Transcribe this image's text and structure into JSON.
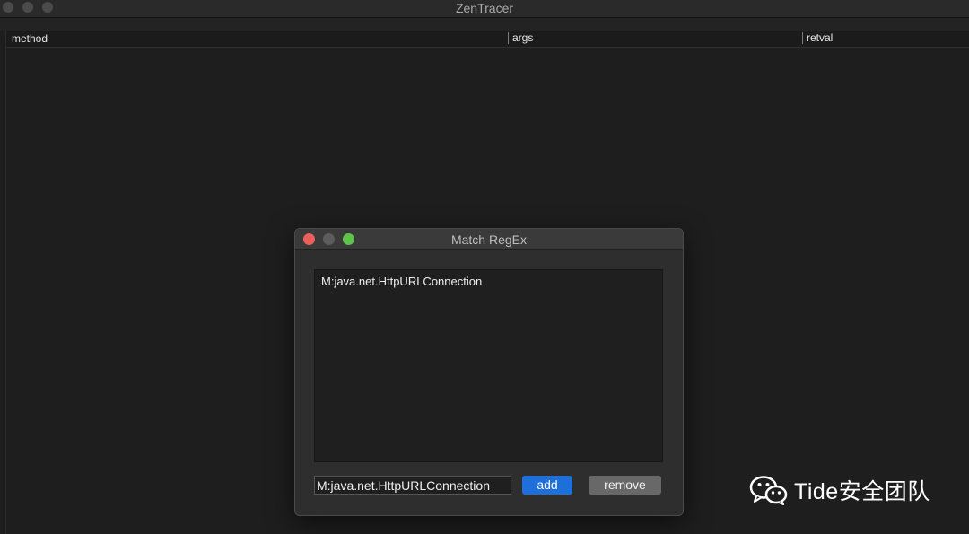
{
  "window": {
    "title": "ZenTracer"
  },
  "table": {
    "columns": [
      "method",
      "args",
      "retval"
    ]
  },
  "dialog": {
    "title": "Match RegEx",
    "list_items": [
      "M:java.net.HttpURLConnection"
    ],
    "input_value": "M:java.net.HttpURLConnection",
    "add_label": "add",
    "remove_label": "remove"
  },
  "watermark": {
    "text": "Tide安全团队",
    "logo_icon": "wechat-logo-icon"
  },
  "colors": {
    "add_button": "#1e6fd9",
    "close_light": "#ec5f5a",
    "max_light": "#5fc24a"
  }
}
